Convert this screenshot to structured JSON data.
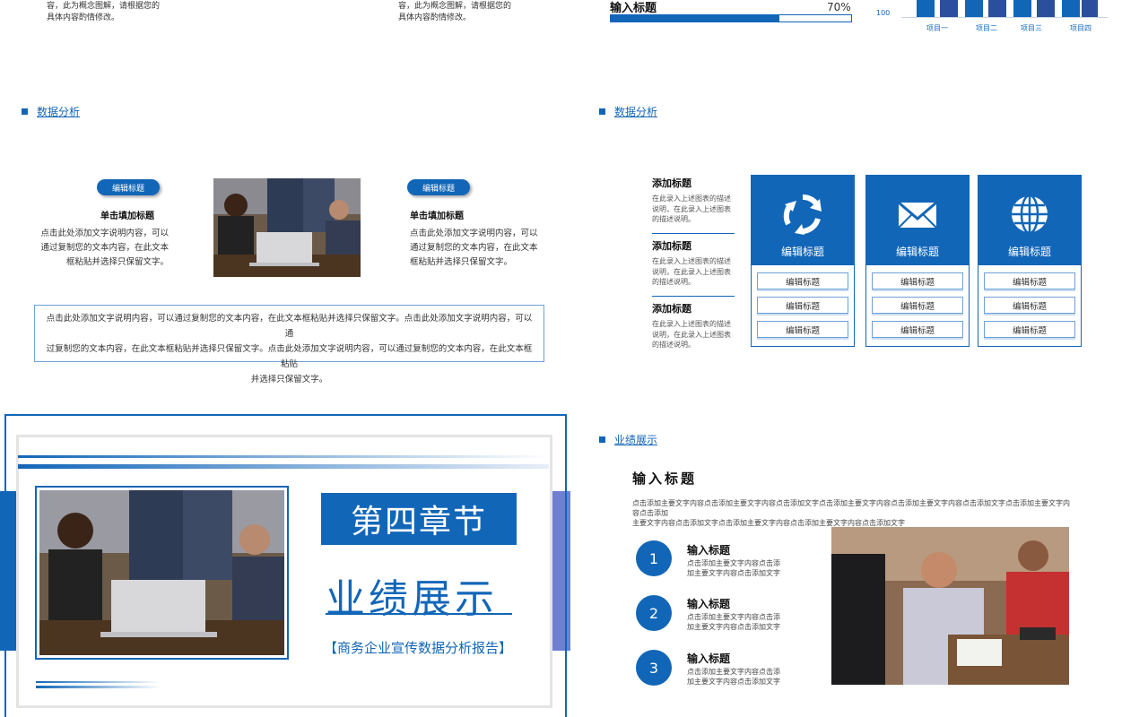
{
  "slide1": {
    "col1_text": [
      "容，此为概念图解，请根据您的",
      "具体内容酌情修改。"
    ],
    "col2_text": [
      "容，此为概念图解，请根据您的",
      "具体内容酌情修改。"
    ]
  },
  "slide2": {
    "progress_title": "输入标题",
    "progress_value_label": "70%",
    "progress_value": 0.7,
    "axis_tick": "100",
    "categories": [
      "项目一",
      "项目二",
      "项目三",
      "项目四"
    ]
  },
  "slide3": {
    "section": "数据分析",
    "left": {
      "pill": "编辑标题",
      "title": "单击填加标题",
      "desc": [
        "点击此处添加文字说明内容，可以",
        "通过复制您的文本内容，在此文本",
        "框粘贴并选择只保留文字。"
      ]
    },
    "right": {
      "pill": "编辑标题",
      "title": "单击填加标题",
      "desc": [
        "点击此处添加文字说明内容，可以",
        "通过复制您的文本内容，在此文本",
        "框粘贴并选择只保留文字。"
      ]
    },
    "note": [
      "点击此处添加文字说明内容，可以通过复制您的文本内容，在此文本框粘贴并选择只保留文字。点击此处添加文字说明内容，可以通",
      "过复制您的文本内容，在此文本框粘贴并选择只保留文字。点击此处添加文字说明内容，可以通过复制您的文本内容，在此文本框粘贴",
      "并选择只保留文字。"
    ]
  },
  "slide4": {
    "section": "数据分析",
    "side": [
      {
        "title": "添加标题",
        "desc": [
          "在此录入上述图表的描述",
          "说明，在此录入上述图表",
          "的描述说明。"
        ]
      },
      {
        "title": "添加标题",
        "desc": [
          "在此录入上述图表的描述",
          "说明，在此录入上述图表",
          "的描述说明。"
        ]
      },
      {
        "title": "添加标题",
        "desc": [
          "在此录入上述图表的描述",
          "说明，在此录入上述图表",
          "的描述说明。"
        ]
      }
    ],
    "cards": [
      {
        "icon": "recycle-icon",
        "label": "编辑标题",
        "rows": [
          "编辑标题",
          "编辑标题",
          "编辑标题"
        ]
      },
      {
        "icon": "envelope-icon",
        "label": "编辑标题",
        "rows": [
          "编辑标题",
          "编辑标题",
          "编辑标题"
        ]
      },
      {
        "icon": "globe-icon",
        "label": "编辑标题",
        "rows": [
          "编辑标题",
          "编辑标题",
          "编辑标题"
        ]
      }
    ]
  },
  "slide5": {
    "chapter": "第四章节",
    "title": "业绩展示",
    "subtitle": "【商务企业宣传数据分析报告】"
  },
  "slide6": {
    "section": "业绩展示",
    "heading": "输入标题",
    "intro": [
      "点击添加主要文字内容点击添加主要文字内容点击添加文字点击添加主要文字内容点击添加主要文字内容点击添加文字点击添加主要文字内容点击添加",
      "主要文字内容点击添加文字点击添加主要文字内容点击添加主要文字内容点击添加文字"
    ],
    "items": [
      {
        "num": "1",
        "title": "输入标题",
        "desc": [
          "点击添加主要文字内容点击添",
          "加主要文字内容点击添加文字"
        ]
      },
      {
        "num": "2",
        "title": "输入标题",
        "desc": [
          "点击添加主要文字内容点击添",
          "加主要文字内容点击添加文字"
        ]
      },
      {
        "num": "3",
        "title": "输入标题",
        "desc": [
          "点击添加主要文字内容点击添",
          "加主要文字内容点击添加文字"
        ]
      }
    ]
  },
  "colors": {
    "accent": "#1266b8",
    "dark_bar": "#2b4f9c",
    "light_line": "#6fa0d8"
  }
}
